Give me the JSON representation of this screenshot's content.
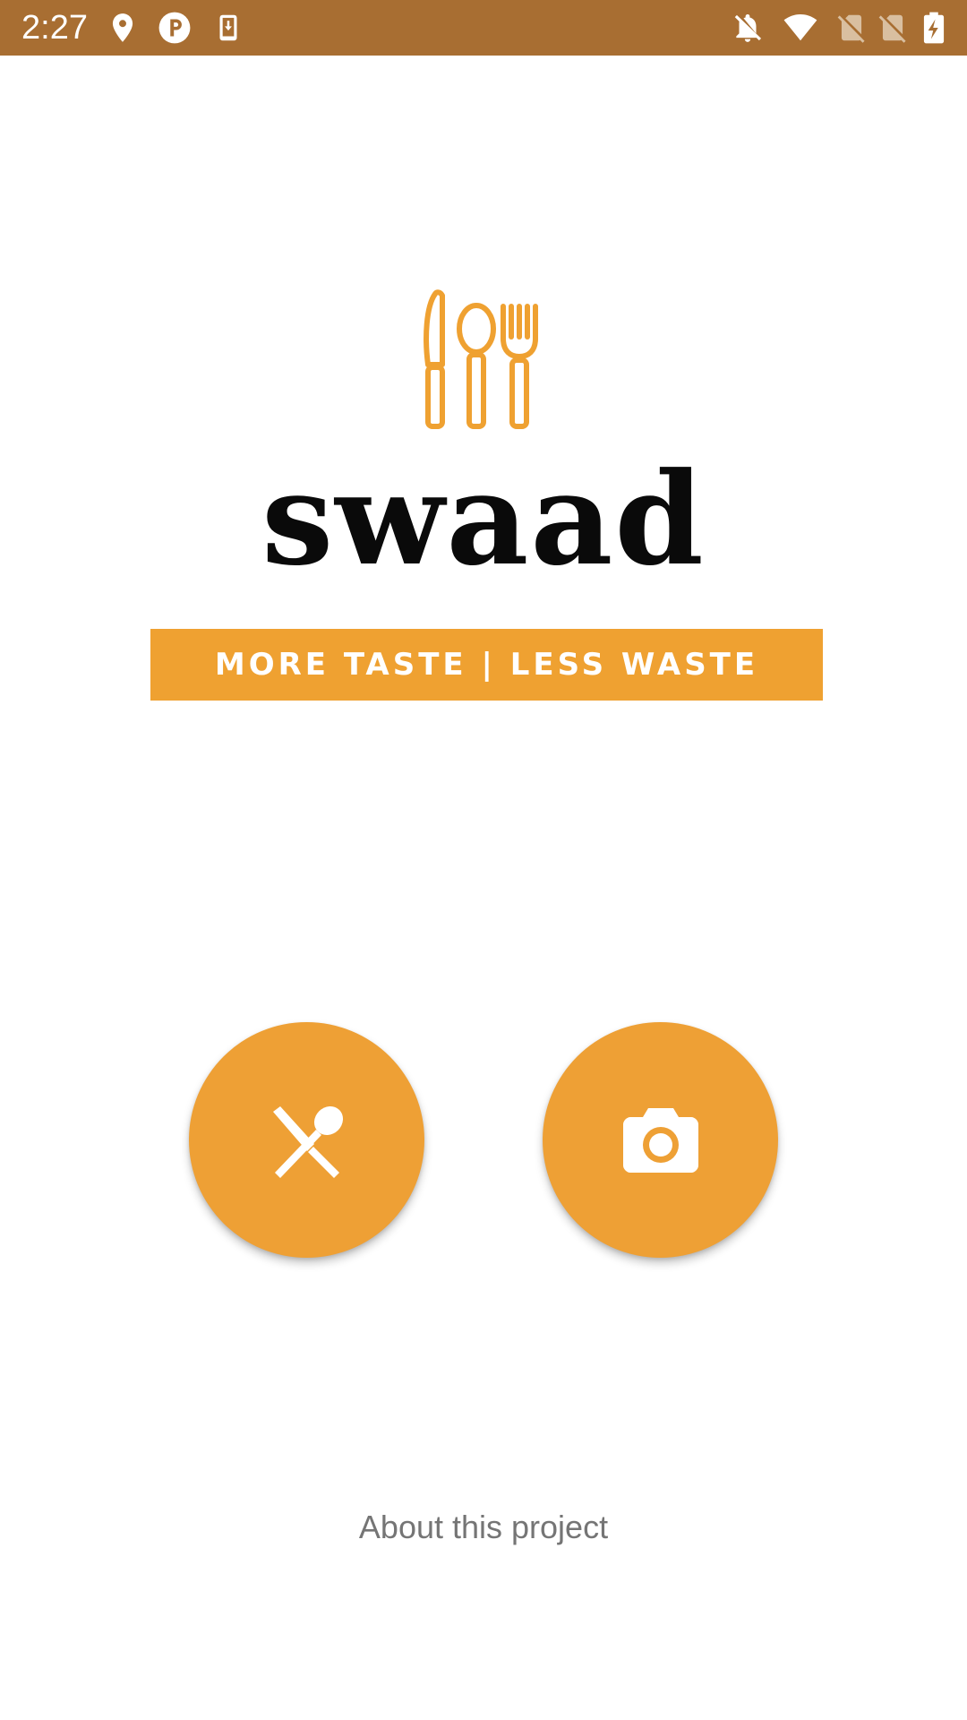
{
  "status_bar": {
    "time": "2:27",
    "background_color": "#a86e32",
    "left_icons": [
      "location-pin-icon",
      "parking-app-icon",
      "download-notification-icon"
    ],
    "right_icons": [
      "notifications-off-icon",
      "wifi-icon",
      "no-sim-icon",
      "no-sim-icon",
      "battery-charging-icon"
    ]
  },
  "branding": {
    "logo_icon": "cutlery-icon",
    "app_name": "swaad",
    "tagline": "MORE TASTE | LESS WASTE",
    "accent_color": "#efa131"
  },
  "actions": {
    "left_button_icon": "restaurant-icon",
    "right_button_icon": "camera-icon",
    "button_color": "#eea035"
  },
  "footer": {
    "about_link": "About this project"
  }
}
